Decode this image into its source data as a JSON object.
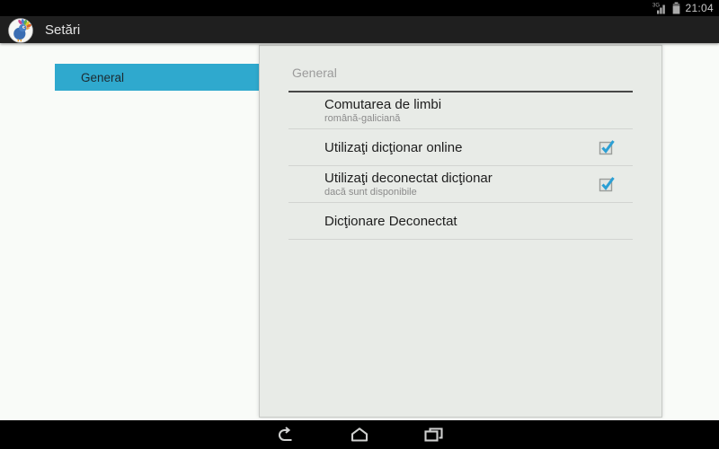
{
  "status_bar": {
    "time": "21:04",
    "network_type": "3G"
  },
  "app_bar": {
    "title": "Setări",
    "app_icon": "dictionary-bird-logo"
  },
  "sidebar": {
    "items": [
      {
        "label": "General",
        "selected": true
      }
    ]
  },
  "panel": {
    "header": "General",
    "items": [
      {
        "title": "Comutarea de limbi",
        "subtitle": "română-galiciană",
        "checkbox": null
      },
      {
        "title": "Utilizaţi dicţionar online",
        "subtitle": "",
        "checkbox": true
      },
      {
        "title": "Utilizaţi deconectat dicţionar",
        "subtitle": "dacă sunt disponibile",
        "checkbox": true
      },
      {
        "title": "Dicţionare Deconectat",
        "subtitle": "",
        "checkbox": null
      }
    ]
  },
  "nav_bar": {
    "buttons": [
      "back",
      "home",
      "recents"
    ]
  },
  "colors": {
    "accent": "#2fa9ce",
    "checkbox_check": "#2b9fd4",
    "card_bg": "#e8ebe7",
    "content_bg": "#f9fbf8",
    "status_bar_bg": "#000000",
    "app_bar_bg": "#1f1f1f"
  }
}
